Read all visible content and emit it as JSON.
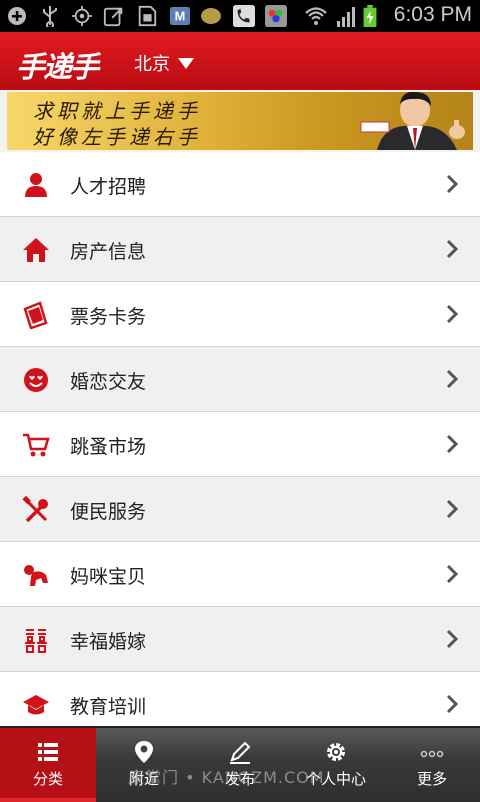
{
  "status_bar": {
    "time": "6:03 PM"
  },
  "header": {
    "logo": "手递手",
    "city": "北京"
  },
  "banner": {
    "line1": "求职就上手递手",
    "line2": "好像左手递右手"
  },
  "categories": [
    {
      "label": "人才招聘",
      "icon": "person-icon"
    },
    {
      "label": "房产信息",
      "icon": "house-icon"
    },
    {
      "label": "票务卡务",
      "icon": "ticket-icon"
    },
    {
      "label": "婚恋交友",
      "icon": "heart-eyes-icon"
    },
    {
      "label": "跳蚤市场",
      "icon": "cart-icon"
    },
    {
      "label": "便民服务",
      "icon": "tools-icon"
    },
    {
      "label": "妈咪宝贝",
      "icon": "baby-icon"
    },
    {
      "label": "幸福婚嫁",
      "icon": "double-happiness-icon"
    },
    {
      "label": "教育培训",
      "icon": "graduation-cap-icon"
    }
  ],
  "tabs": [
    {
      "label": "分类",
      "icon": "list-icon",
      "active": true
    },
    {
      "label": "附近",
      "icon": "location-pin-icon"
    },
    {
      "label": "发布",
      "icon": "pencil-icon"
    },
    {
      "label": "个人中心",
      "icon": "gear-icon"
    },
    {
      "label": "更多",
      "icon": "more-dots-icon"
    }
  ],
  "watermark": "康掌门 • KANGZM.COM",
  "colors": {
    "brand_red": "#d8141b",
    "icon_red": "#d0121a",
    "tab_active": "#b51016"
  }
}
